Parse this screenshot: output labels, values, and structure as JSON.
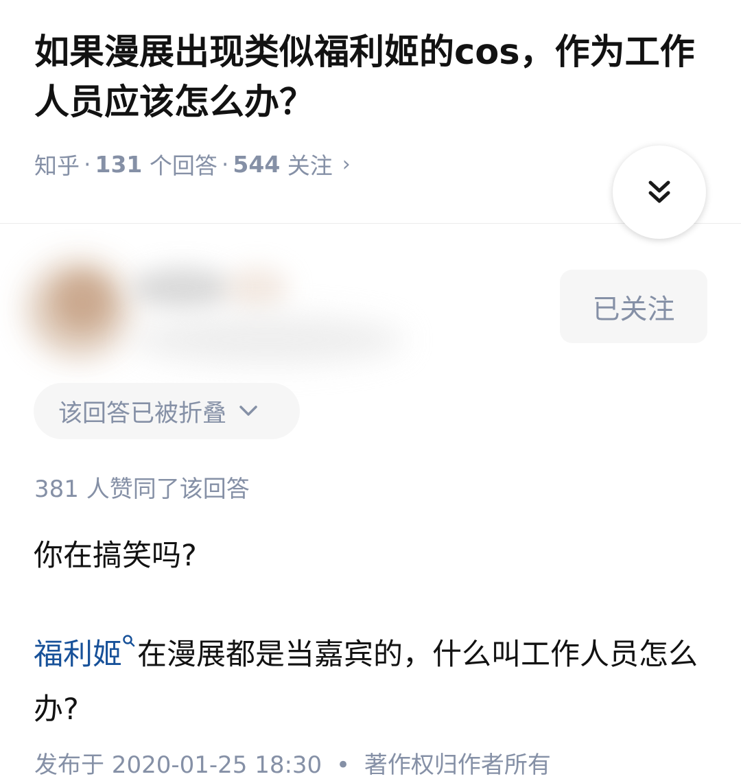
{
  "question": {
    "title": "如果漫展出现类似福利姬的cos，作为工作人员应该怎么办？",
    "source": "知乎",
    "answer_count": "131",
    "answer_label": "个回答",
    "follower_count": "544",
    "follower_label": "关注",
    "separator": "·",
    "more_chevron": "›"
  },
  "expand_button": {
    "icon": "double-chevron-down-icon"
  },
  "author": {
    "follow_label": "已关注"
  },
  "folded_notice": {
    "label": "该回答已被折叠",
    "icon": "chevron-down-icon"
  },
  "answer": {
    "upvote_text": "381 人赞同了该回答",
    "paragraph1": "你在搞笑吗?",
    "term_link": "福利姬",
    "term_icon": "search-icon",
    "paragraph2_rest": "在漫展都是当嘉宾的，什么叫工作人员怎么办?",
    "published": "发布于 2020-01-25 18:30",
    "separator": "•",
    "copyright": "著作权归作者所有"
  },
  "colors": {
    "link": "#175199",
    "meta_gray": "#8590a6",
    "title": "#121212",
    "pill_bg": "#f6f6f6"
  }
}
